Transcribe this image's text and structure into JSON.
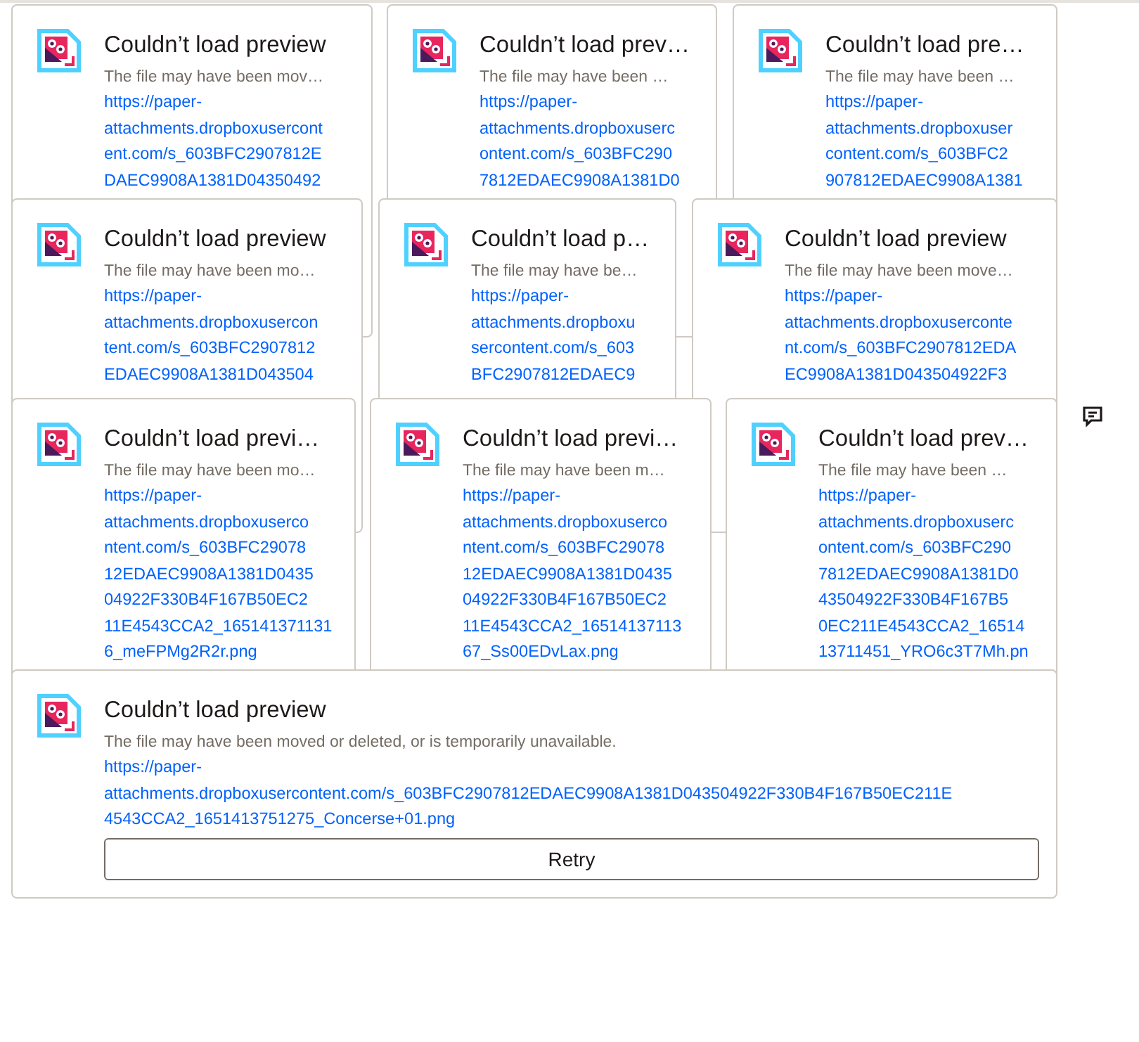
{
  "cards": [
    {
      "title": "Couldn’t load preview",
      "message": "The file may have been mov…",
      "url_lines": [
        "https://paper-",
        "attachments.dropboxusercont",
        "ent.com/s_603BFC2907812E",
        "DAEC9908A1381D04350492"
      ]
    },
    {
      "title": "Couldn’t load prev…",
      "message": "The file may have been …",
      "url_lines": [
        "https://paper-",
        "attachments.dropboxuserc",
        "ontent.com/s_603BFC290",
        "7812EDAEC9908A1381D0"
      ]
    },
    {
      "title": "Couldn’t load pre…",
      "message": "The file may have been …",
      "url_lines": [
        "https://paper-",
        "attachments.dropboxuser",
        "content.com/s_603BFC2",
        "907812EDAEC9908A1381"
      ]
    },
    {
      "title": "Couldn’t load preview",
      "message": "The file may have been mo…",
      "url_lines": [
        "https://paper-",
        "attachments.dropboxusercon",
        "tent.com/s_603BFC2907812",
        "EDAEC9908A1381D043504"
      ]
    },
    {
      "title": "Couldn’t load p…",
      "message": "The file may have be…",
      "url_lines": [
        "https://paper-",
        "attachments.dropboxu",
        "sercontent.com/s_603",
        "BFC2907812EDAEC9"
      ]
    },
    {
      "title": "Couldn’t load preview",
      "message": "The file may have been move…",
      "url_lines": [
        "https://paper-",
        "attachments.dropboxuserconte",
        "nt.com/s_603BFC2907812EDA",
        "EC9908A1381D043504922F3"
      ]
    },
    {
      "title": "Couldn’t load previ…",
      "message": "The file may have been mo…",
      "url_lines": [
        "https://paper-",
        "attachments.dropboxuserco",
        "ntent.com/s_603BFC29078",
        "12EDAEC9908A1381D0435",
        "04922F330B4F167B50EC2",
        "11E4543CCA2_165141371131",
        "6_meFPMg2R2r.png"
      ]
    },
    {
      "title": "Couldn’t load previ…",
      "message": "The file may have been m…",
      "url_lines": [
        "https://paper-",
        "attachments.dropboxuserco",
        "ntent.com/s_603BFC29078",
        "12EDAEC9908A1381D0435",
        "04922F330B4F167B50EC2",
        "11E4543CCA2_16514137113",
        "67_Ss00EDvLax.png"
      ]
    },
    {
      "title": "Couldn’t load prev…",
      "message": "The file may have been …",
      "url_lines": [
        "https://paper-",
        "attachments.dropboxuserc",
        "ontent.com/s_603BFC290",
        "7812EDAEC9908A1381D0",
        "43504922F330B4F167B5",
        "0EC211E4543CCA2_16514",
        "13711451_YRO6c3T7Mh.pn"
      ]
    },
    {
      "title": "Couldn’t load preview",
      "message": "The file may have been moved or deleted, or is temporarily unavailable.",
      "url_lines": [
        "https://paper-",
        "attachments.dropboxusercontent.com/s_603BFC2907812EDAEC9908A1381D043504922F330B4F167B50EC211E",
        "4543CCA2_1651413751275_Concerse+01.png"
      ],
      "button": "Retry"
    }
  ]
}
